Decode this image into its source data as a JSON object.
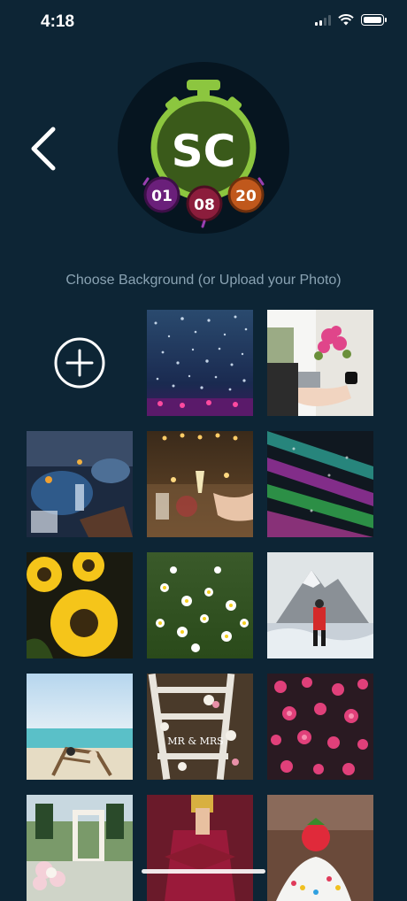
{
  "status_bar": {
    "time": "4:18"
  },
  "logo": {
    "letters": "SC",
    "dates": [
      "01",
      "08",
      "20"
    ]
  },
  "subtitle": "Choose Background (or Upload your Photo)",
  "grid": {
    "tiles": [
      "add-photo",
      "confetti-concert",
      "wedding-hands",
      "dinner-table",
      "champagne-toast",
      "colorful-lasers",
      "sunflowers",
      "daisy-field",
      "snowy-mountain-hiker",
      "beach-chairs",
      "mr-mrs-ladder",
      "pink-flowers",
      "wedding-arch",
      "graduation-cap",
      "strawberry-cake"
    ]
  },
  "colors": {
    "background": "#0d2535",
    "clock_green": "#8cc63f",
    "badge_purple": "#6a1f7a",
    "badge_maroon": "#8c1d3c",
    "badge_orange": "#c0581c"
  }
}
